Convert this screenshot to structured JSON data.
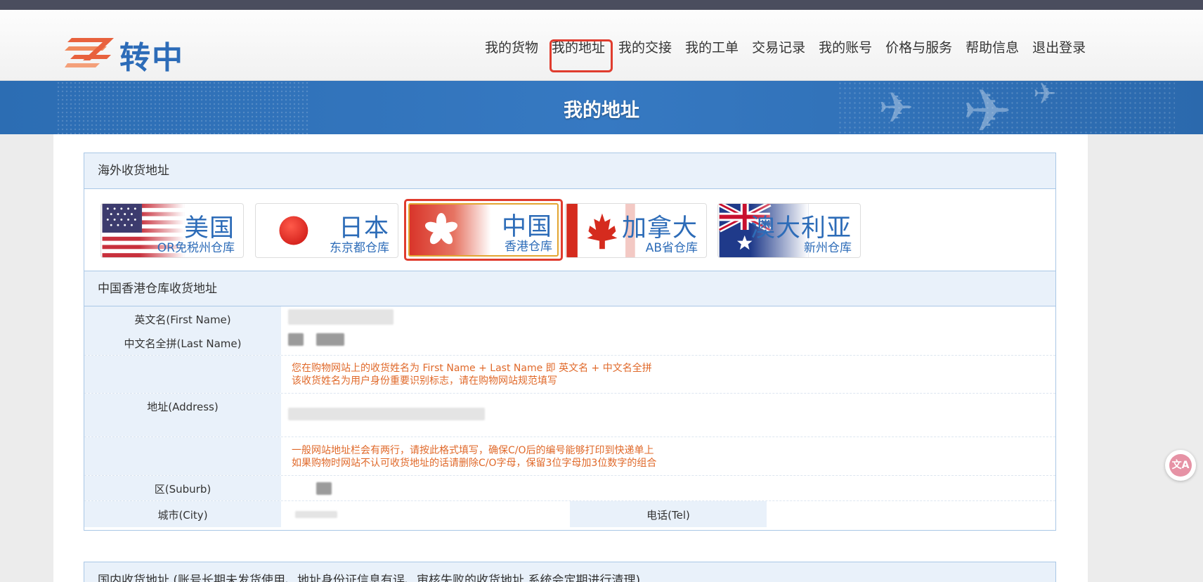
{
  "brand": {
    "name": "转中"
  },
  "nav": {
    "items": [
      "我的货物",
      "我的地址",
      "我的交接",
      "我的工单",
      "交易记录",
      "我的账号",
      "价格与服务",
      "帮助信息",
      "退出登录"
    ],
    "active_index": 1
  },
  "banner": {
    "title": "我的地址"
  },
  "overseas": {
    "title": "海外收货地址",
    "warehouses": [
      {
        "country": "美国",
        "name": "OR免税州仓库",
        "flag": "us-flag-icon"
      },
      {
        "country": "日本",
        "name": "东京都仓库",
        "flag": "japan-flag-icon"
      },
      {
        "country": "中国",
        "name": "香港仓库",
        "flag": "hongkong-flag-icon",
        "selected": true
      },
      {
        "country": "加拿大",
        "name": "AB省仓库",
        "flag": "canada-flag-icon"
      },
      {
        "country": "澳大利亚",
        "name": "新州仓库",
        "flag": "australia-flag-icon"
      }
    ]
  },
  "address": {
    "title": "中国香港仓库收货地址",
    "first_name_label": "英文名(First Name)",
    "last_name_label": "中文名全拼(Last Name)",
    "name_note_1": "您在购物网站上的收货姓名为 First Name + Last Name 即 英文名 + 中文名全拼",
    "name_note_2": "该收货姓名为用户身份重要识别标志，请在购物网站规范填写",
    "address_label": "地址(Address)",
    "address_note_1": "一般网站地址栏会有两行，请按此格式填写，确保C/O后的编号能够打印到快递单上",
    "address_note_2": "如果购物时网站不认可收货地址的话请删除C/O字母，保留3位字母加3位数字的组合",
    "suburb_label": "区(Suburb)",
    "city_label": "城市(City)",
    "tel_label": "电话(Tel)"
  },
  "domestic": {
    "title": "国内收货地址 (账号长期未发货使用、地址身份证信息有误、审核失败的收货地址 系统会定期进行清理)"
  },
  "colors": {
    "brand_blue": "#2d6cb8",
    "highlight_red": "#e03c2e",
    "note_orange": "#e0692a",
    "panel_bg": "#e9f1fa"
  }
}
